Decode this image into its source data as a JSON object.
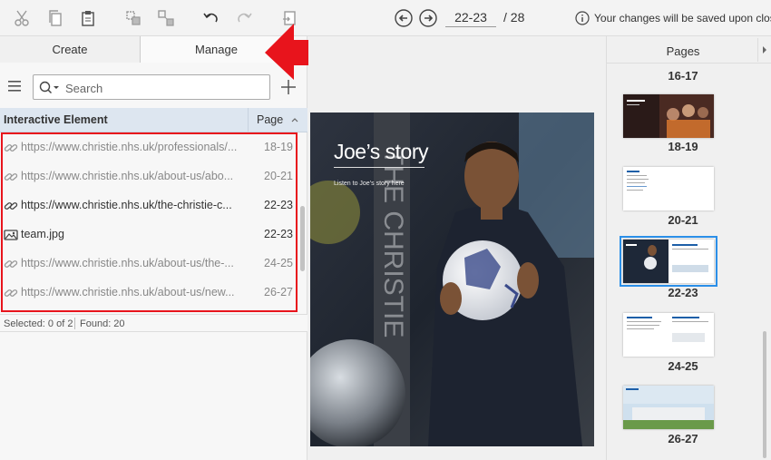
{
  "toolbar": {
    "page_current": "22-23",
    "page_total": "/ 28",
    "save_note": "Your changes will be saved upon close"
  },
  "tabs": {
    "create": "Create",
    "manage": "Manage"
  },
  "search": {
    "placeholder": "Search"
  },
  "table": {
    "col_element": "Interactive Element",
    "col_page": "Page",
    "rows": [
      {
        "text": "https://www.christie.nhs.uk/professionals/...",
        "page": "18-19",
        "icon": "link-icon"
      },
      {
        "text": "https://www.christie.nhs.uk/about-us/abo...",
        "page": "20-21",
        "icon": "link-icon"
      },
      {
        "text": "https://www.christie.nhs.uk/the-christie-c...",
        "page": "22-23",
        "icon": "link-icon"
      },
      {
        "text": "team.jpg",
        "page": "22-23",
        "icon": "image-icon"
      },
      {
        "text": "https://www.christie.nhs.uk/about-us/the-...",
        "page": "24-25",
        "icon": "link-icon"
      },
      {
        "text": "https://www.christie.nhs.uk/about-us/new...",
        "page": "26-27",
        "icon": "link-icon"
      }
    ]
  },
  "status": {
    "selected": "Selected: 0 of 2",
    "found": "Found: 20"
  },
  "canvas": {
    "title": "Joe’s story",
    "subtitle": "Listen to Joe’s story here"
  },
  "pages_panel": {
    "title": "Pages",
    "labels": [
      "16-17",
      "18-19",
      "20-21",
      "22-23",
      "24-25",
      "26-27"
    ]
  },
  "colors": {
    "accent": "#2b8fe8",
    "highlight": "#e8141c",
    "header_bg": "#dde6f0"
  }
}
